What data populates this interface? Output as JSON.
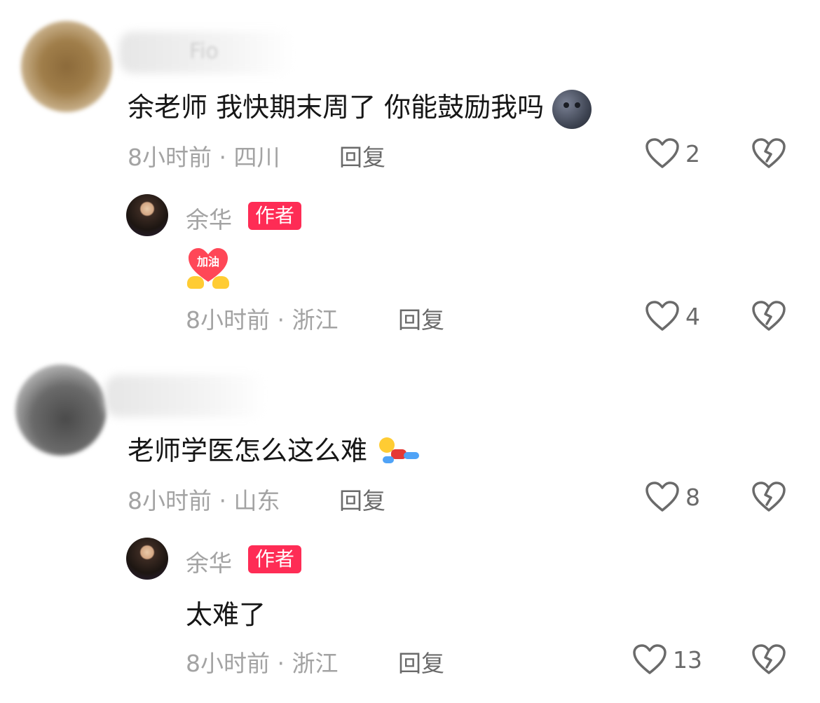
{
  "comments": [
    {
      "username_partial": "Fio",
      "text": "余老师 我快期末周了 你能鼓励我吗",
      "emoji": "new-moon-face",
      "meta": "8小时前 · 四川",
      "reply_label": "回复",
      "likes": "2",
      "reply": {
        "name": "余华",
        "badge": "作者",
        "sticker_text": "加油",
        "meta": "8小时前 · 浙江",
        "reply_label": "回复",
        "likes": "4"
      }
    },
    {
      "text": "老师学医怎么这么难",
      "emoji": "lying-down-person",
      "meta": "8小时前 · 山东",
      "reply_label": "回复",
      "likes": "8",
      "reply": {
        "name": "余华",
        "badge": "作者",
        "text": "太难了",
        "meta": "8小时前 · 浙江",
        "reply_label": "回复",
        "likes": "13"
      }
    }
  ],
  "colors": {
    "badge": "#fe2c55",
    "meta_text": "#a3a3a3",
    "main_text": "#161616"
  }
}
